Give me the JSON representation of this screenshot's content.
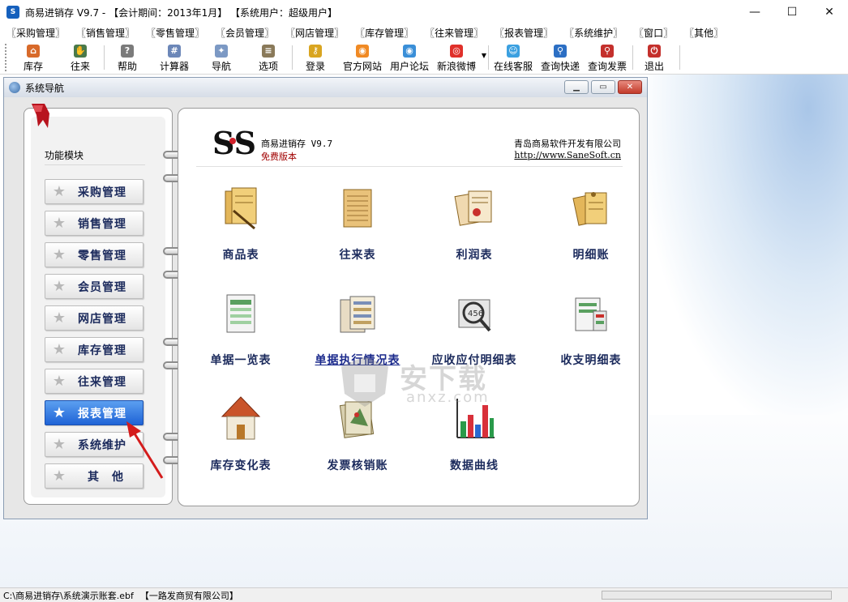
{
  "window": {
    "title": "商易进销存 V9.7 - 【会计期间：2013年1月】 【系统用户：超级用户】",
    "controls": [
      "—",
      "☐",
      "✕"
    ]
  },
  "menu": [
    "〖采购管理〗",
    "〖销售管理〗",
    "〖零售管理〗",
    "〖会员管理〗",
    "〖网店管理〗",
    "〖库存管理〗",
    "〖往来管理〗",
    "〖报表管理〗",
    "〖系统维护〗",
    "〖窗口〗",
    "〖其他〗"
  ],
  "toolbar": [
    {
      "label": "库存",
      "icon": "home-icon",
      "color": "#d86a2a"
    },
    {
      "label": "往来",
      "icon": "handshake-icon",
      "color": "#4a7a4a"
    },
    {
      "label": "帮助",
      "icon": "help-icon",
      "color": "#7b7b7b"
    },
    {
      "label": "计算器",
      "icon": "calculator-icon",
      "color": "#6c87b8"
    },
    {
      "label": "导航",
      "icon": "navigation-icon",
      "color": "#7c99c4"
    },
    {
      "label": "选项",
      "icon": "options-icon",
      "color": "#8a7a5a"
    },
    {
      "label": "登录",
      "icon": "login-key-icon",
      "color": "#d9a520"
    },
    {
      "label": "官方网站",
      "icon": "rss-icon",
      "color": "#f08a24"
    },
    {
      "label": "用户论坛",
      "icon": "rss-forum-icon",
      "color": "#3a8fd8"
    },
    {
      "label": "新浪微博",
      "icon": "weibo-icon",
      "color": "#e0302a"
    },
    {
      "label": "在线客服",
      "icon": "chat-icon",
      "color": "#3ba0e0"
    },
    {
      "label": "查询快递",
      "icon": "search-icon",
      "color": "#2c6fc4"
    },
    {
      "label": "查询发票",
      "icon": "search-invoice-icon",
      "color": "#c4302c"
    },
    {
      "label": "退出",
      "icon": "exit-icon",
      "color": "#c4302c"
    }
  ],
  "nav_window": {
    "title": "系统导航",
    "controls": [
      "▁",
      "▭",
      "✕"
    ]
  },
  "left_panel": {
    "title": "功能模块",
    "modules": [
      "采购管理",
      "销售管理",
      "零售管理",
      "会员管理",
      "网店管理",
      "库存管理",
      "往来管理",
      "报表管理",
      "系统维护",
      "其　他"
    ],
    "active": "报表管理"
  },
  "header": {
    "logo": "SS",
    "product": "商易进销存 V9.7",
    "edition": "免费版本",
    "company": "青岛商易软件开发有限公司",
    "url": "http://www.SaneSoft.cn"
  },
  "reports": [
    {
      "label": "商品表",
      "icon": "goods-table-icon"
    },
    {
      "label": "往来表",
      "icon": "account-table-icon"
    },
    {
      "label": "利润表",
      "icon": "profit-table-icon"
    },
    {
      "label": "明细账",
      "icon": "ledger-icon"
    },
    {
      "label": "单据一览表",
      "icon": "voucher-list-icon"
    },
    {
      "label": "单据执行情况表",
      "icon": "voucher-status-icon"
    },
    {
      "label": "应收应付明细表",
      "icon": "receivable-payable-icon"
    },
    {
      "label": "收支明细表",
      "icon": "income-expense-icon"
    },
    {
      "label": "库存变化表",
      "icon": "warehouse-house-icon"
    },
    {
      "label": "发票核销账",
      "icon": "invoice-icon"
    },
    {
      "label": "数据曲线",
      "icon": "bar-chart-icon"
    }
  ],
  "watermark": {
    "cn": "安下载",
    "en": "anxz.com"
  },
  "status": {
    "path": "C:\\商易进销存\\系统演示账套.ebf",
    "company": "【一路发商贸有限公司】"
  }
}
